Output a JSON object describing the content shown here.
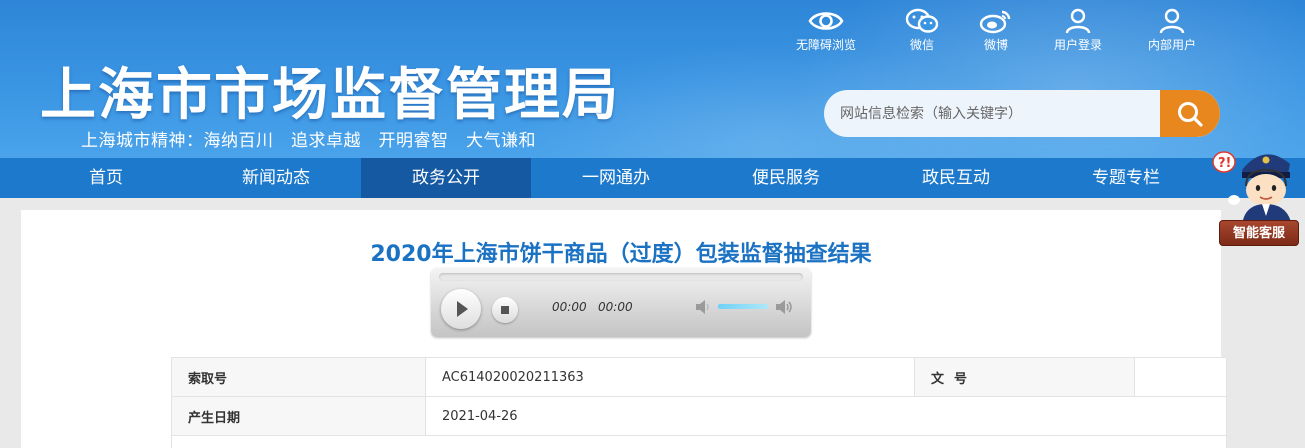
{
  "header": {
    "site_title": "上海市市场监督管理局",
    "slogan": "上海城市精神：海纳百川　追求卓越　开明睿智　大气谦和",
    "links": [
      {
        "label": "无障碍浏览",
        "icon": "eye-icon"
      },
      {
        "label": "微信",
        "icon": "wechat-icon"
      },
      {
        "label": "微博",
        "icon": "weibo-icon"
      },
      {
        "label": "用户登录",
        "icon": "user-icon"
      },
      {
        "label": "内部用户",
        "icon": "user-icon"
      }
    ],
    "search": {
      "placeholder": "网站信息检索（输入关键字）",
      "button_icon": "search-icon"
    }
  },
  "nav": {
    "items": [
      "首页",
      "新闻动态",
      "政务公开",
      "一网通办",
      "便民服务",
      "政民互动",
      "专题专栏"
    ],
    "active": "政务公开"
  },
  "chatbot": {
    "label": "智能客服",
    "icon": "customer-service-avatar-icon"
  },
  "article": {
    "title": "2020年上海市饼干商品（过度）包装监督抽查结果",
    "player": {
      "current_time": "00:00",
      "duration": "00:00"
    },
    "meta": {
      "index_label": "索取号",
      "index_value": "AC614020020211363",
      "doc_no_label": "文号",
      "doc_no_value": "",
      "date_label": "产生日期",
      "date_value": "2021-04-26"
    }
  },
  "colors": {
    "header_blue": "#3a95e3",
    "nav_blue": "#1d79cc",
    "nav_active": "#1559a2",
    "title_blue": "#1b72c3",
    "search_orange": "#e8871e"
  }
}
